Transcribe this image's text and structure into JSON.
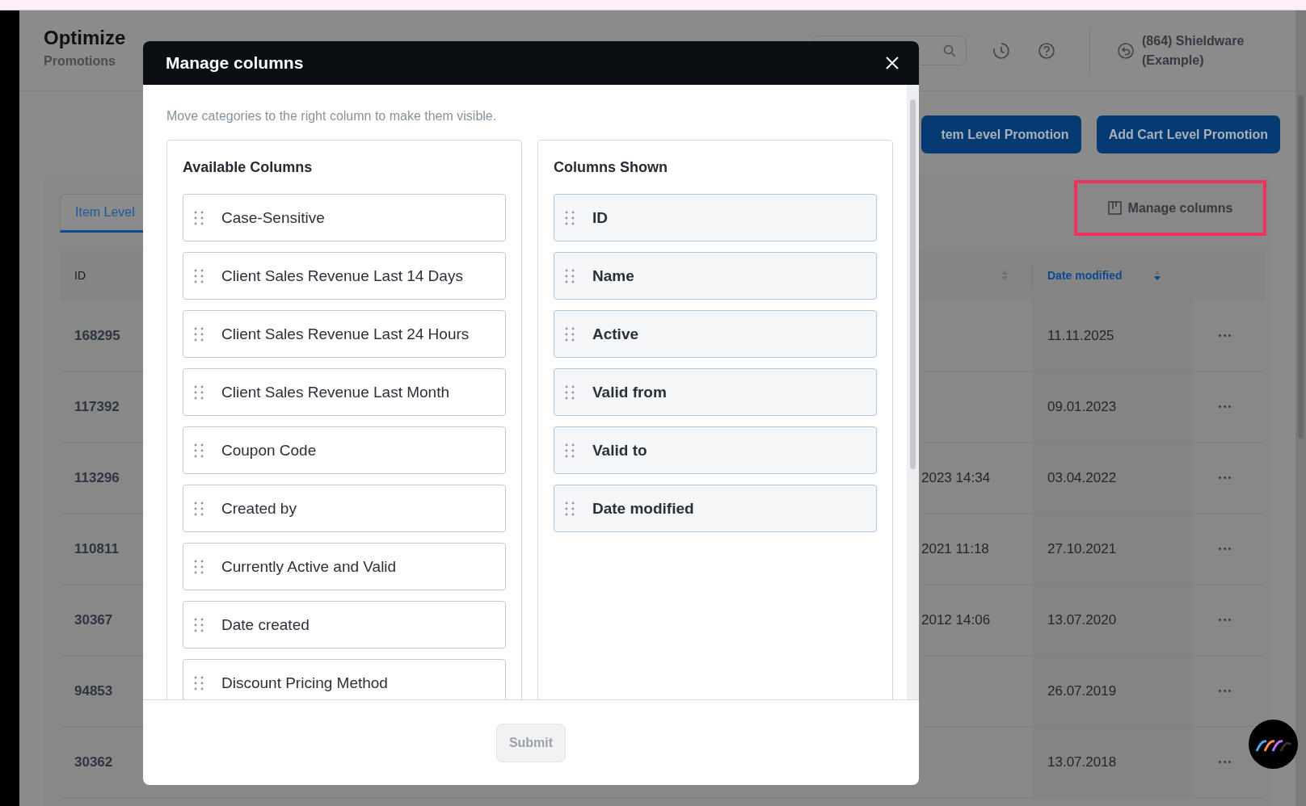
{
  "app": {
    "title": "Optimize",
    "subtitle": "Promotions"
  },
  "header": {
    "search": {
      "kind": "search"
    },
    "account": "(864) Shieldware (Example)"
  },
  "actions": [
    {
      "label": "tem Level Promotion"
    },
    {
      "label": "Add Cart Level Promotion"
    }
  ],
  "tabs": [
    {
      "label": "Item Level",
      "selected": true
    }
  ],
  "manage_columns": {
    "label": "Manage columns",
    "highlighted": true
  },
  "table": {
    "columns": [
      {
        "label": "ID",
        "sorted": false
      },
      {
        "sorted": false
      },
      {
        "label": "Date modified",
        "sorted": true
      }
    ],
    "rows": [
      {
        "id": "168295",
        "date_modified": "11.11.2025"
      },
      {
        "id": "117392",
        "date_modified": "09.01.2023"
      },
      {
        "id": "113296",
        "column_2": "2023 14:34",
        "date_modified": "03.04.2022"
      },
      {
        "id": "110811",
        "column_2": "2021 11:18",
        "date_modified": "27.10.2021"
      },
      {
        "id": "30367",
        "column_2": "2012 14:06",
        "date_modified": "13.07.2020"
      },
      {
        "id": "94853",
        "date_modified": "26.07.2019"
      },
      {
        "id": "30362",
        "date_modified": "13.07.2018"
      }
    ]
  },
  "modal": {
    "title": "Manage columns",
    "subtitle": "Move categories to the right column to make them visible.",
    "available": {
      "title": "Available Columns",
      "items": [
        "Case-Sensitive",
        "Client Sales Revenue Last 14 Days",
        "Client Sales Revenue Last 24 Hours",
        "Client Sales Revenue Last Month",
        "Coupon Code",
        "Created by",
        "Currently Active and Valid",
        "Date created",
        "Discount Pricing Method"
      ]
    },
    "shown": {
      "title": "Columns Shown",
      "items": [
        "ID",
        "Name",
        "Active",
        "Valid from",
        "Valid to",
        "Date modified"
      ]
    },
    "submit": {
      "label": "Submit",
      "disabled": true
    }
  }
}
